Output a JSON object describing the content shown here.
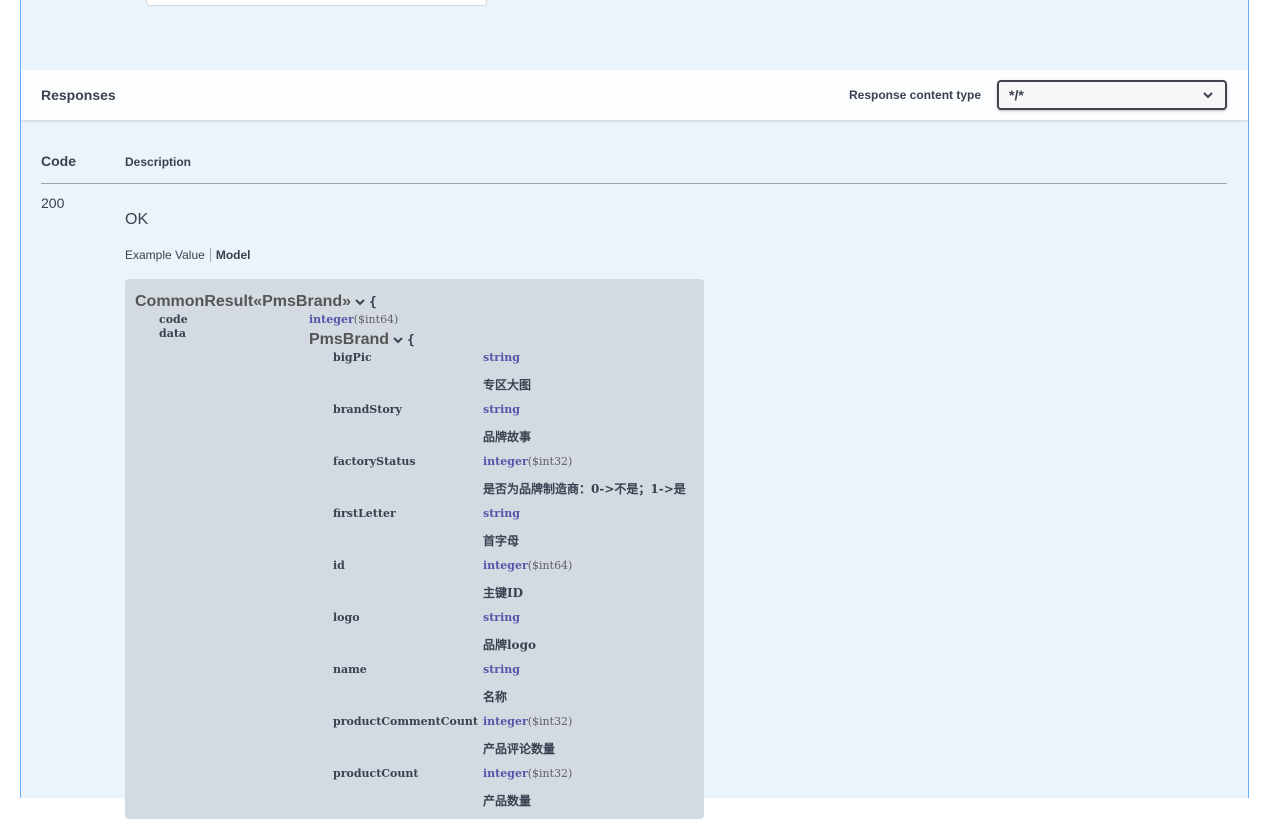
{
  "responses": {
    "title": "Responses",
    "content_type_label": "Response content type",
    "content_type_value": "*/*"
  },
  "table": {
    "code_header": "Code",
    "description_header": "Description"
  },
  "response_200": {
    "code": "200",
    "description": "OK",
    "tabs": {
      "example": "Example Value",
      "model": "Model"
    }
  },
  "model": {
    "outer_title": "CommonResult«PmsBrand»",
    "open_brace": "{",
    "code_name": "code",
    "code_type": "integer",
    "code_format": "($int64)",
    "data_name": "data",
    "inner_title": "PmsBrand",
    "properties": [
      {
        "name": "bigPic",
        "type": "string",
        "format": "",
        "desc": "专区大图"
      },
      {
        "name": "brandStory",
        "type": "string",
        "format": "",
        "desc": "品牌故事"
      },
      {
        "name": "factoryStatus",
        "type": "integer",
        "format": "($int32)",
        "desc": "是否为品牌制造商：0->不是；1->是"
      },
      {
        "name": "firstLetter",
        "type": "string",
        "format": "",
        "desc": "首字母"
      },
      {
        "name": "id",
        "type": "integer",
        "format": "($int64)",
        "desc": "主键ID"
      },
      {
        "name": "logo",
        "type": "string",
        "format": "",
        "desc": "品牌logo"
      },
      {
        "name": "name",
        "type": "string",
        "format": "",
        "desc": "名称"
      },
      {
        "name": "productCommentCount",
        "type": "integer",
        "format": "($int32)",
        "desc": "产品评论数量"
      },
      {
        "name": "productCount",
        "type": "integer",
        "format": "($int32)",
        "desc": "产品数量"
      }
    ]
  },
  "colors": {
    "accent": "#61affe",
    "panel": "#ebf3fb",
    "model_bg": "#d4dae2",
    "type": "#55aa"
  }
}
